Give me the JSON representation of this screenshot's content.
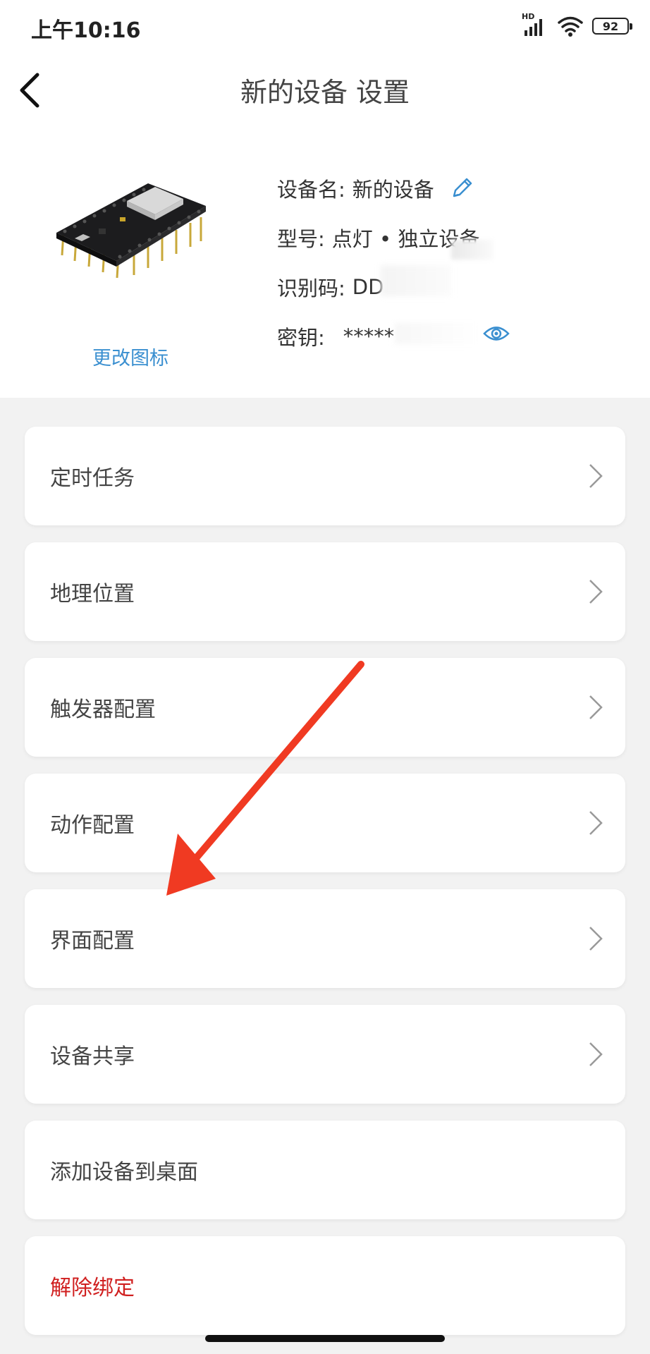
{
  "status_bar": {
    "time": "上午10:16",
    "network_label": "HD",
    "battery": "92"
  },
  "header": {
    "title": "新的设备 设置"
  },
  "device": {
    "change_icon_label": "更改图标",
    "name_label": "设备名:",
    "name_value": "新的设备",
    "model_label": "型号:",
    "model_value": "点灯 • 独立设备",
    "id_label": "识别码:",
    "id_value": "DD",
    "key_label": "密钥:",
    "key_value": "*****"
  },
  "menu": [
    {
      "label": "定时任务",
      "has_chevron": true
    },
    {
      "label": "地理位置",
      "has_chevron": true
    },
    {
      "label": "触发器配置",
      "has_chevron": true
    },
    {
      "label": "动作配置",
      "has_chevron": true
    },
    {
      "label": "界面配置",
      "has_chevron": true
    },
    {
      "label": "设备共享",
      "has_chevron": true
    },
    {
      "label": "添加设备到桌面",
      "has_chevron": false
    },
    {
      "label": "解除绑定",
      "has_chevron": false
    }
  ],
  "colors": {
    "accent": "#3a8fd0",
    "danger": "#d02020",
    "annotation_arrow": "#f03a22",
    "background": "#f2f2f2"
  },
  "icons": {
    "back": "back-arrow-icon",
    "edit": "pencil-icon",
    "reveal": "eye-icon",
    "chevron": "chevron-right-icon"
  }
}
